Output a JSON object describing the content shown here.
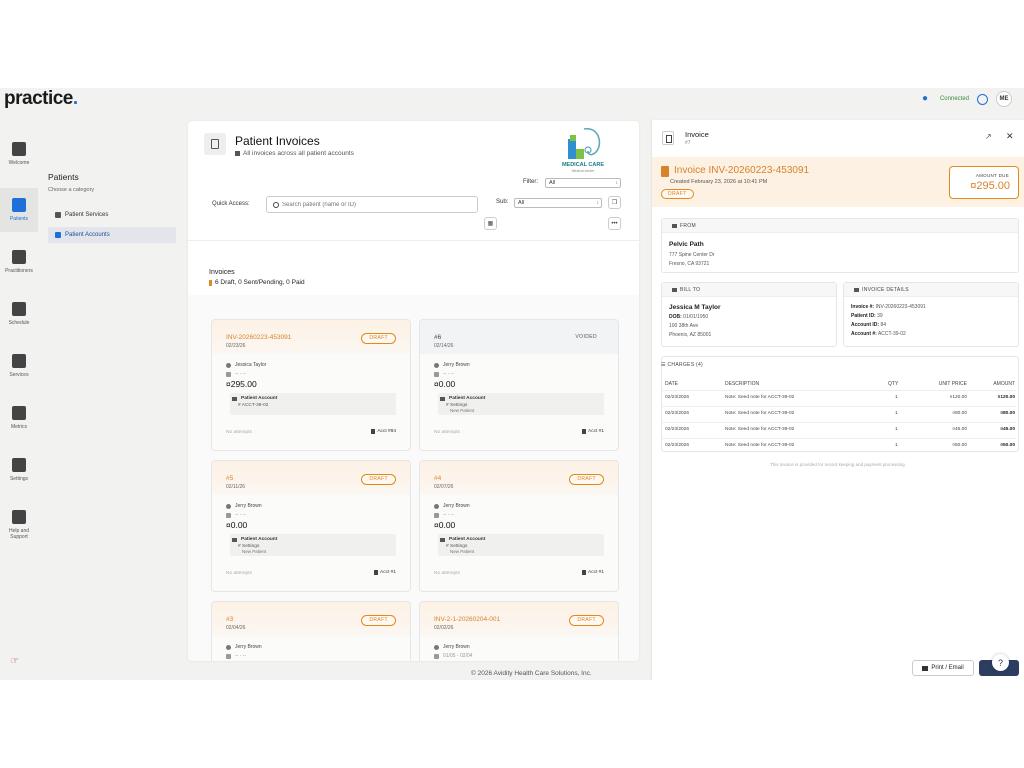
{
  "app": {
    "logo_text": "practice",
    "logo_dot": ".",
    "connection_status": "Connected",
    "user_initials": "ME",
    "icons": {
      "notifications": "bell-icon",
      "clock": "clock-icon"
    }
  },
  "rail": {
    "items": [
      {
        "label": "Welcome",
        "icon": "home-icon",
        "active": false
      },
      {
        "label": "Patients",
        "icon": "user-check-icon",
        "active": true
      },
      {
        "label": "Practitioners",
        "icon": "practitioner-icon",
        "active": false
      },
      {
        "label": "Schedule",
        "icon": "calendar-icon",
        "active": false
      },
      {
        "label": "Services",
        "icon": "layers-icon",
        "active": false
      },
      {
        "label": "Metrics",
        "icon": "pie-chart-icon",
        "active": false
      },
      {
        "label": "Settings",
        "icon": "gear-icon",
        "active": false
      },
      {
        "label": "Help and Support",
        "icon": "help-icon",
        "active": false
      }
    ]
  },
  "subnav": {
    "title": "Patients",
    "hint": "Choose a category",
    "items": [
      {
        "label": "Patient Services",
        "active": false
      },
      {
        "label": "Patient Accounts",
        "active": true
      }
    ]
  },
  "main": {
    "title": "Patient Invoices",
    "subtitle": "All invoices across all patient accounts",
    "brand_name": "MEDICAL CARE",
    "brand_tagline": "Medical center",
    "filter_label": "Filter:",
    "filter_value": "All",
    "quick_access_label": "Quick Access:",
    "search_placeholder": "Search patient (name or ID)",
    "sub_label": "Sub:",
    "sub_value": "All",
    "invoices_title": "Invoices",
    "invoices_summary": "6 Draft, 0 Sent/Pending, 0 Paid",
    "cards": [
      {
        "number": "INV-20260223-453091",
        "date": "02/23/26",
        "status": "DRAFT",
        "patient": "Jessica Taylor",
        "period": "-- - --",
        "amount": "¤295.00",
        "account_label": "Patient Account",
        "account": "ACCT-39-02",
        "account_note": "",
        "attempts": "No attempts",
        "ref": "Acct #84"
      },
      {
        "number": "#6",
        "date": "02/14/26",
        "status": "VOIDED",
        "patient": "Jerry Brown",
        "period": "-- - --",
        "amount": "¤0.00",
        "account_label": "Patient Account",
        "account": "Settings",
        "account_note": "New Patient",
        "attempts": "No attempts",
        "ref": "Acct #1"
      },
      {
        "number": "#5",
        "date": "02/11/26",
        "status": "DRAFT",
        "patient": "Jerry Brown",
        "period": "-- - --",
        "amount": "¤0.00",
        "account_label": "Patient Account",
        "account": "Settings",
        "account_note": "New Patient",
        "attempts": "No attempts",
        "ref": "Acct #1"
      },
      {
        "number": "#4",
        "date": "02/07/26",
        "status": "DRAFT",
        "patient": "Jerry Brown",
        "period": "-- - --",
        "amount": "¤0.00",
        "account_label": "Patient Account",
        "account": "Settings",
        "account_note": "New Patient",
        "attempts": "No attempts",
        "ref": "Acct #1"
      },
      {
        "number": "#3",
        "date": "02/04/26",
        "status": "DRAFT",
        "patient": "Jerry Brown",
        "period": "-- - --",
        "amount": "",
        "account_label": "",
        "account": "",
        "account_note": "",
        "attempts": "",
        "ref": ""
      },
      {
        "number": "INV-2-1-20260204-001",
        "date": "02/02/26",
        "status": "DRAFT",
        "patient": "Jerry Brown",
        "period": "01/05 - 02/04",
        "amount": "",
        "account_label": "",
        "account": "",
        "account_note": "",
        "attempts": "",
        "ref": ""
      }
    ],
    "footer": "© 2026 Avidity Health Care Solutions, Inc."
  },
  "detail": {
    "title": "Invoice",
    "subtitle": "#7",
    "invoice_number": "Invoice INV-20260223-453091",
    "created": "Created February 23, 2026 at 10:41 PM",
    "status": "DRAFT",
    "amount_due_label": "AMOUNT DUE",
    "amount_due": "¤295.00",
    "from": {
      "header": "FROM",
      "name": "Pelvic Path",
      "address1": "777 Spine Center Dr",
      "address2": "Fresno, CA 93721"
    },
    "bill_to": {
      "header": "BILL TO",
      "name": "Jessica M Taylor",
      "dob_label": "DOB:",
      "dob": "01/01/1950",
      "address1": "100 38th Ave",
      "address2": "Phoenix, AZ 85001"
    },
    "invoice_details": {
      "header": "INVOICE DETAILS",
      "rows": [
        {
          "label": "Invoice #:",
          "value": "INV-20260223-453091"
        },
        {
          "label": "Patient ID:",
          "value": "39"
        },
        {
          "label": "Account ID:",
          "value": "84"
        },
        {
          "label": "Account #:",
          "value": "ACCT-39-02"
        }
      ]
    },
    "charges": {
      "header": "CHARGES (4)",
      "columns": [
        "DATE",
        "DESCRIPTION",
        "QTY",
        "UNIT PRICE",
        "AMOUNT"
      ],
      "rows": [
        {
          "date": "02/23/2026",
          "description": "Note: Seed note for ACCT-39-02",
          "qty": "1",
          "unit_price": "¤120.00",
          "amount": "¤120.00"
        },
        {
          "date": "02/23/2026",
          "description": "Note: Seed note for ACCT-39-02",
          "qty": "1",
          "unit_price": "¤80.00",
          "amount": "¤80.00"
        },
        {
          "date": "02/23/2026",
          "description": "Note: Seed note for ACCT-39-02",
          "qty": "1",
          "unit_price": "¤45.00",
          "amount": "¤45.00"
        },
        {
          "date": "02/23/2026",
          "description": "Note: Seed note for ACCT-39-02",
          "qty": "1",
          "unit_price": "¤50.00",
          "amount": "¤50.00"
        }
      ],
      "note": "This invoice is provided for record keeping and payment processing."
    },
    "print_label": "Print / Email",
    "help_glyph": "?"
  },
  "colors": {
    "accent": "#1f6fd8",
    "draft": "#d9822b",
    "draft_bg": "#fdf1e4"
  }
}
